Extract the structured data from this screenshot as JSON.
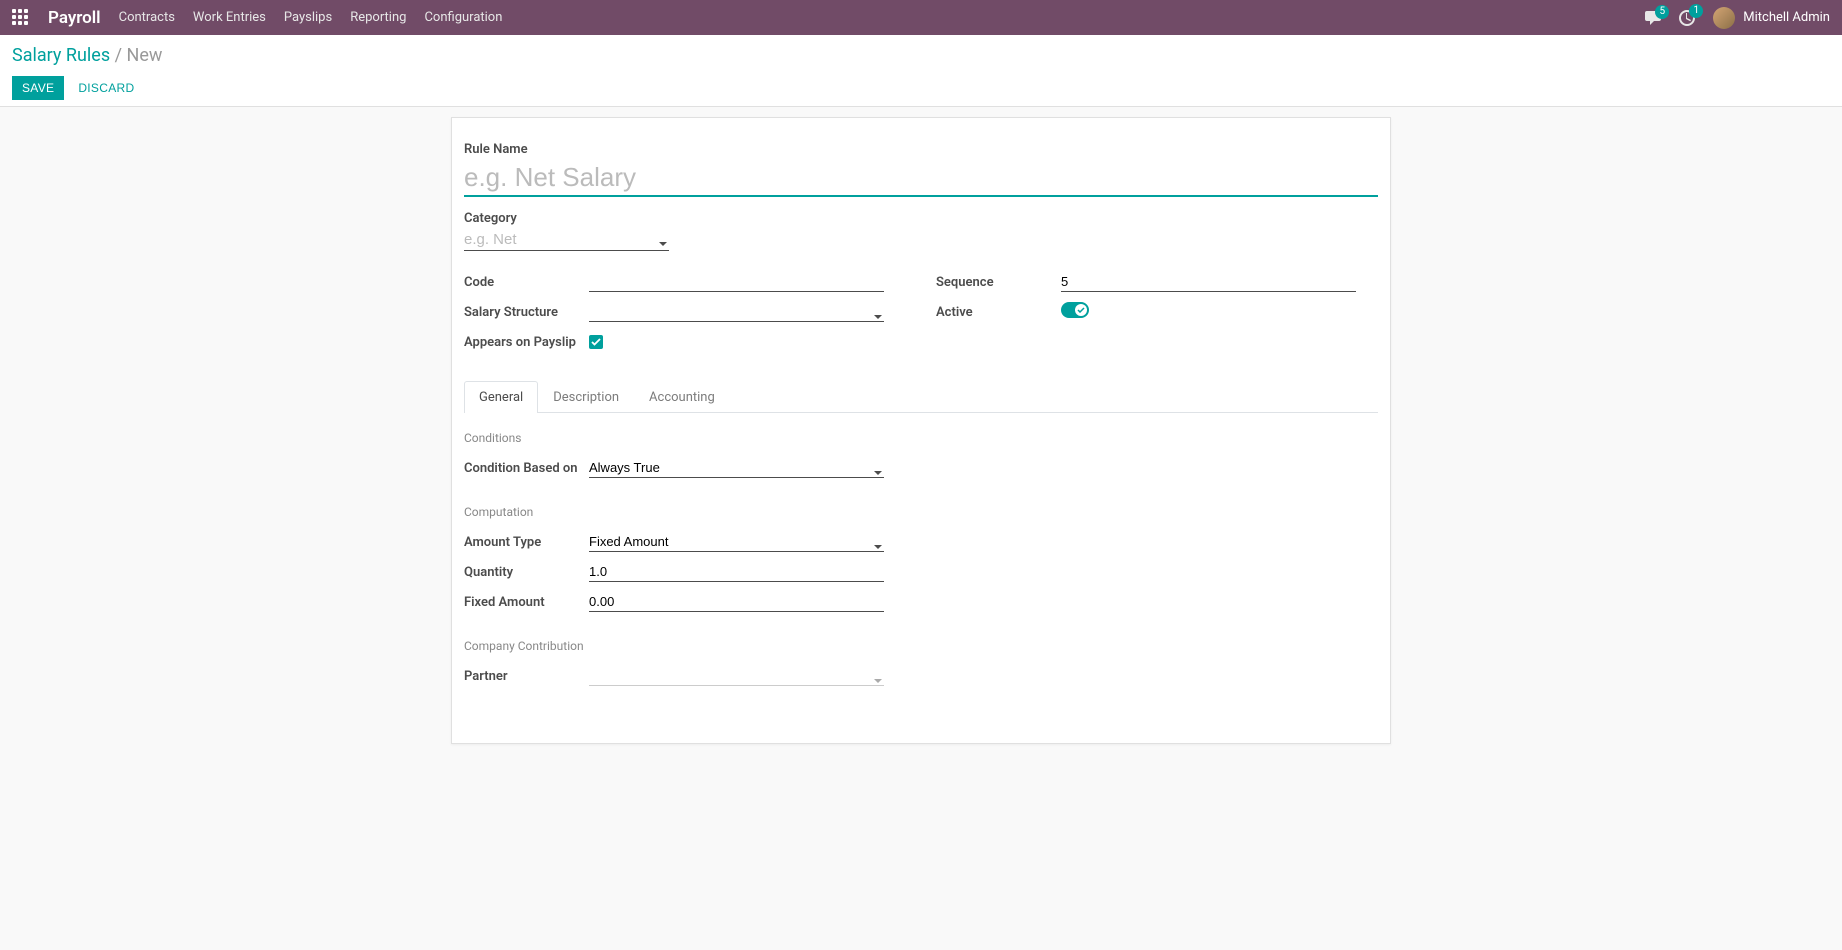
{
  "navbar": {
    "brand": "Payroll",
    "links": [
      "Contracts",
      "Work Entries",
      "Payslips",
      "Reporting",
      "Configuration"
    ],
    "messages_badge": "5",
    "activities_badge": "1",
    "user_name": "Mitchell Admin"
  },
  "breadcrumb": {
    "link": "Salary Rules",
    "current": "New"
  },
  "actions": {
    "save": "SAVE",
    "discard": "DISCARD"
  },
  "form": {
    "rule_name_label": "Rule Name",
    "rule_name_placeholder": "e.g. Net Salary",
    "rule_name_value": "",
    "category_label": "Category",
    "category_placeholder": "e.g. Net",
    "category_value": "",
    "code_label": "Code",
    "code_value": "",
    "salary_structure_label": "Salary Structure",
    "salary_structure_value": "",
    "appears_on_payslip_label": "Appears on Payslip",
    "sequence_label": "Sequence",
    "sequence_value": "5",
    "active_label": "Active",
    "tabs": {
      "general": "General",
      "description": "Description",
      "accounting": "Accounting"
    },
    "conditions_title": "Conditions",
    "condition_based_on_label": "Condition Based on",
    "condition_based_on_value": "Always True",
    "computation_title": "Computation",
    "amount_type_label": "Amount Type",
    "amount_type_value": "Fixed Amount",
    "quantity_label": "Quantity",
    "quantity_value": "1.0",
    "fixed_amount_label": "Fixed Amount",
    "fixed_amount_value": "0.00",
    "company_contribution_title": "Company Contribution",
    "partner_label": "Partner",
    "partner_value": ""
  }
}
